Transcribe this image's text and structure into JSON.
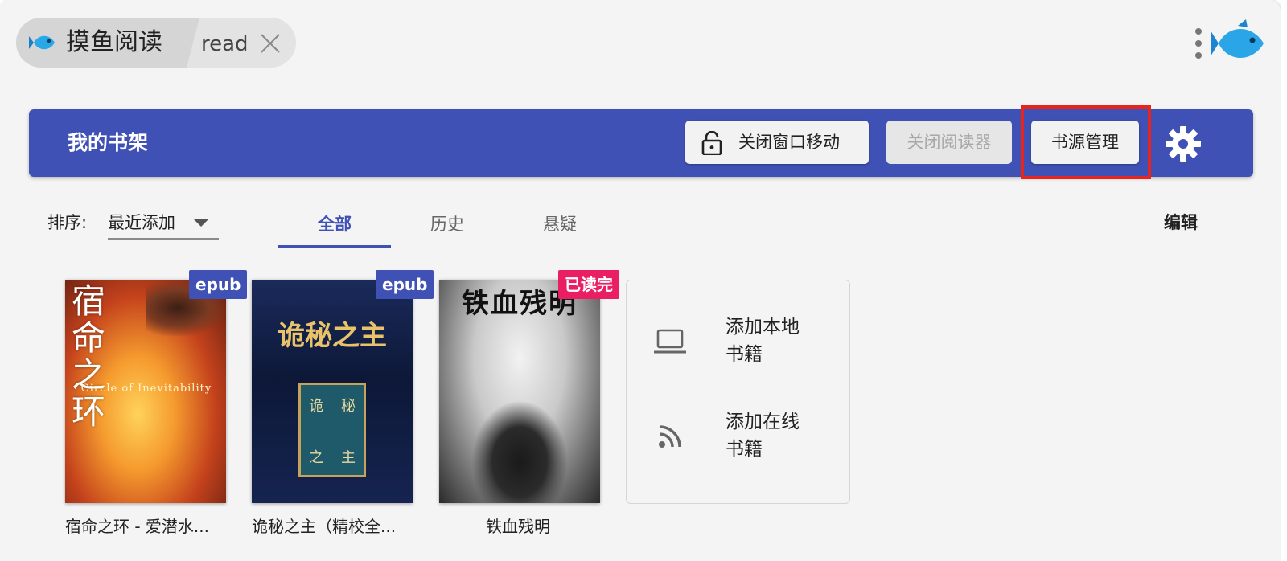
{
  "window": {
    "app_tab_title": "摸鱼阅读",
    "second_tab": "read",
    "icons": {
      "app": "fish-icon",
      "close": "close-icon",
      "menu": "more-vert-icon",
      "logo": "fish-logo-icon"
    }
  },
  "appbar": {
    "title": "我的书架",
    "lock_button": "关闭窗口移动",
    "close_reader_button": "关闭阅读器",
    "source_button": "书源管理",
    "colors": {
      "bar": "#3f51b5",
      "highlight": "#e8251c"
    }
  },
  "toolbar": {
    "sort_label": "排序:",
    "sort_value": "最近添加",
    "tabs": [
      "全部",
      "历史",
      "悬疑"
    ],
    "active_tab": "全部",
    "edit": "编辑"
  },
  "books": [
    {
      "name": "宿命之环 - 爱潜水...",
      "badge": "epub",
      "cover_title": "宿命之环",
      "cover_subtitle": "Circle of Inevitability"
    },
    {
      "name": "诡秘之主（精校全...",
      "badge": "epub",
      "cover_title": "诡秘之主",
      "cover_box": [
        "诡",
        "秘",
        "之",
        "主"
      ]
    },
    {
      "name": "铁血残明",
      "badge": "已读完",
      "cover_title": "铁血残明"
    }
  ],
  "add_card": {
    "local": [
      "添加本地",
      "书籍"
    ],
    "online": [
      "添加在线",
      "书籍"
    ]
  }
}
